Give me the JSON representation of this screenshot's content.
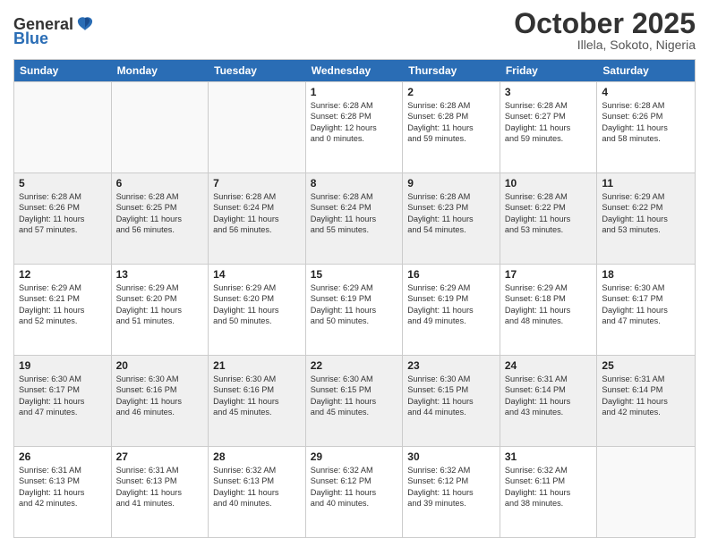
{
  "header": {
    "logo_general": "General",
    "logo_blue": "Blue",
    "title": "October 2025",
    "location": "Illela, Sokoto, Nigeria"
  },
  "days_of_week": [
    "Sunday",
    "Monday",
    "Tuesday",
    "Wednesday",
    "Thursday",
    "Friday",
    "Saturday"
  ],
  "rows": [
    [
      {
        "day": "",
        "empty": true
      },
      {
        "day": "",
        "empty": true
      },
      {
        "day": "",
        "empty": true
      },
      {
        "day": "1",
        "lines": [
          "Sunrise: 6:28 AM",
          "Sunset: 6:28 PM",
          "Daylight: 12 hours",
          "and 0 minutes."
        ]
      },
      {
        "day": "2",
        "lines": [
          "Sunrise: 6:28 AM",
          "Sunset: 6:28 PM",
          "Daylight: 11 hours",
          "and 59 minutes."
        ]
      },
      {
        "day": "3",
        "lines": [
          "Sunrise: 6:28 AM",
          "Sunset: 6:27 PM",
          "Daylight: 11 hours",
          "and 59 minutes."
        ]
      },
      {
        "day": "4",
        "lines": [
          "Sunrise: 6:28 AM",
          "Sunset: 6:26 PM",
          "Daylight: 11 hours",
          "and 58 minutes."
        ]
      }
    ],
    [
      {
        "day": "5",
        "lines": [
          "Sunrise: 6:28 AM",
          "Sunset: 6:26 PM",
          "Daylight: 11 hours",
          "and 57 minutes."
        ]
      },
      {
        "day": "6",
        "lines": [
          "Sunrise: 6:28 AM",
          "Sunset: 6:25 PM",
          "Daylight: 11 hours",
          "and 56 minutes."
        ]
      },
      {
        "day": "7",
        "lines": [
          "Sunrise: 6:28 AM",
          "Sunset: 6:24 PM",
          "Daylight: 11 hours",
          "and 56 minutes."
        ]
      },
      {
        "day": "8",
        "lines": [
          "Sunrise: 6:28 AM",
          "Sunset: 6:24 PM",
          "Daylight: 11 hours",
          "and 55 minutes."
        ]
      },
      {
        "day": "9",
        "lines": [
          "Sunrise: 6:28 AM",
          "Sunset: 6:23 PM",
          "Daylight: 11 hours",
          "and 54 minutes."
        ]
      },
      {
        "day": "10",
        "lines": [
          "Sunrise: 6:28 AM",
          "Sunset: 6:22 PM",
          "Daylight: 11 hours",
          "and 53 minutes."
        ]
      },
      {
        "day": "11",
        "lines": [
          "Sunrise: 6:29 AM",
          "Sunset: 6:22 PM",
          "Daylight: 11 hours",
          "and 53 minutes."
        ]
      }
    ],
    [
      {
        "day": "12",
        "lines": [
          "Sunrise: 6:29 AM",
          "Sunset: 6:21 PM",
          "Daylight: 11 hours",
          "and 52 minutes."
        ]
      },
      {
        "day": "13",
        "lines": [
          "Sunrise: 6:29 AM",
          "Sunset: 6:20 PM",
          "Daylight: 11 hours",
          "and 51 minutes."
        ]
      },
      {
        "day": "14",
        "lines": [
          "Sunrise: 6:29 AM",
          "Sunset: 6:20 PM",
          "Daylight: 11 hours",
          "and 50 minutes."
        ]
      },
      {
        "day": "15",
        "lines": [
          "Sunrise: 6:29 AM",
          "Sunset: 6:19 PM",
          "Daylight: 11 hours",
          "and 50 minutes."
        ]
      },
      {
        "day": "16",
        "lines": [
          "Sunrise: 6:29 AM",
          "Sunset: 6:19 PM",
          "Daylight: 11 hours",
          "and 49 minutes."
        ]
      },
      {
        "day": "17",
        "lines": [
          "Sunrise: 6:29 AM",
          "Sunset: 6:18 PM",
          "Daylight: 11 hours",
          "and 48 minutes."
        ]
      },
      {
        "day": "18",
        "lines": [
          "Sunrise: 6:30 AM",
          "Sunset: 6:17 PM",
          "Daylight: 11 hours",
          "and 47 minutes."
        ]
      }
    ],
    [
      {
        "day": "19",
        "lines": [
          "Sunrise: 6:30 AM",
          "Sunset: 6:17 PM",
          "Daylight: 11 hours",
          "and 47 minutes."
        ]
      },
      {
        "day": "20",
        "lines": [
          "Sunrise: 6:30 AM",
          "Sunset: 6:16 PM",
          "Daylight: 11 hours",
          "and 46 minutes."
        ]
      },
      {
        "day": "21",
        "lines": [
          "Sunrise: 6:30 AM",
          "Sunset: 6:16 PM",
          "Daylight: 11 hours",
          "and 45 minutes."
        ]
      },
      {
        "day": "22",
        "lines": [
          "Sunrise: 6:30 AM",
          "Sunset: 6:15 PM",
          "Daylight: 11 hours",
          "and 45 minutes."
        ]
      },
      {
        "day": "23",
        "lines": [
          "Sunrise: 6:30 AM",
          "Sunset: 6:15 PM",
          "Daylight: 11 hours",
          "and 44 minutes."
        ]
      },
      {
        "day": "24",
        "lines": [
          "Sunrise: 6:31 AM",
          "Sunset: 6:14 PM",
          "Daylight: 11 hours",
          "and 43 minutes."
        ]
      },
      {
        "day": "25",
        "lines": [
          "Sunrise: 6:31 AM",
          "Sunset: 6:14 PM",
          "Daylight: 11 hours",
          "and 42 minutes."
        ]
      }
    ],
    [
      {
        "day": "26",
        "lines": [
          "Sunrise: 6:31 AM",
          "Sunset: 6:13 PM",
          "Daylight: 11 hours",
          "and 42 minutes."
        ]
      },
      {
        "day": "27",
        "lines": [
          "Sunrise: 6:31 AM",
          "Sunset: 6:13 PM",
          "Daylight: 11 hours",
          "and 41 minutes."
        ]
      },
      {
        "day": "28",
        "lines": [
          "Sunrise: 6:32 AM",
          "Sunset: 6:13 PM",
          "Daylight: 11 hours",
          "and 40 minutes."
        ]
      },
      {
        "day": "29",
        "lines": [
          "Sunrise: 6:32 AM",
          "Sunset: 6:12 PM",
          "Daylight: 11 hours",
          "and 40 minutes."
        ]
      },
      {
        "day": "30",
        "lines": [
          "Sunrise: 6:32 AM",
          "Sunset: 6:12 PM",
          "Daylight: 11 hours",
          "and 39 minutes."
        ]
      },
      {
        "day": "31",
        "lines": [
          "Sunrise: 6:32 AM",
          "Sunset: 6:11 PM",
          "Daylight: 11 hours",
          "and 38 minutes."
        ]
      },
      {
        "day": "",
        "empty": true
      }
    ]
  ]
}
